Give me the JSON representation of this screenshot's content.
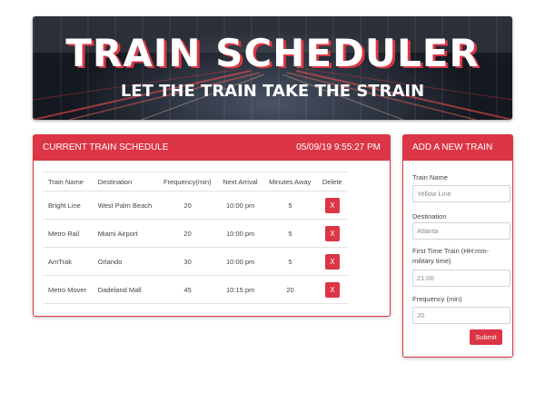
{
  "hero": {
    "title": "TRAIN SCHEDULER",
    "subtitle": "LET THE TRAIN TAKE THE STRAIN"
  },
  "schedule": {
    "heading": "CURRENT TRAIN SCHEDULE",
    "clock": "05/09/19 9:55:27 pm",
    "columns": [
      "Train Name",
      "Destination",
      "Frequency(min)",
      "Next Arrival",
      "Minutes Away",
      "Delete"
    ],
    "rows": [
      {
        "name": "Bright Line",
        "destination": "West Palm Beach",
        "frequency": "20",
        "next": "10:00 pm",
        "away": "5",
        "delete": "X"
      },
      {
        "name": "Metro Rail",
        "destination": "Miami Airport",
        "frequency": "20",
        "next": "10:00 pm",
        "away": "5",
        "delete": "X"
      },
      {
        "name": "AmTrak",
        "destination": "Orlando",
        "frequency": "30",
        "next": "10:00 pm",
        "away": "5",
        "delete": "X"
      },
      {
        "name": "Metro Mover",
        "destination": "Dadeland Mall",
        "frequency": "45",
        "next": "10:15 pm",
        "away": "20",
        "delete": "X"
      }
    ]
  },
  "form": {
    "heading": "ADD A NEW TRAIN",
    "name_label": "Train Name",
    "name_value": "Yellow Line",
    "destination_label": "Destination",
    "destination_value": "Atlanta",
    "first_time_label": "First Time Train (HH:mm-military time)",
    "first_time_value": "21:00",
    "frequency_label": "Frequency (min)",
    "frequency_value": "20",
    "submit_label": "Submit"
  },
  "colors": {
    "accent": "#dc3545",
    "title_shadow": "#d93845"
  }
}
